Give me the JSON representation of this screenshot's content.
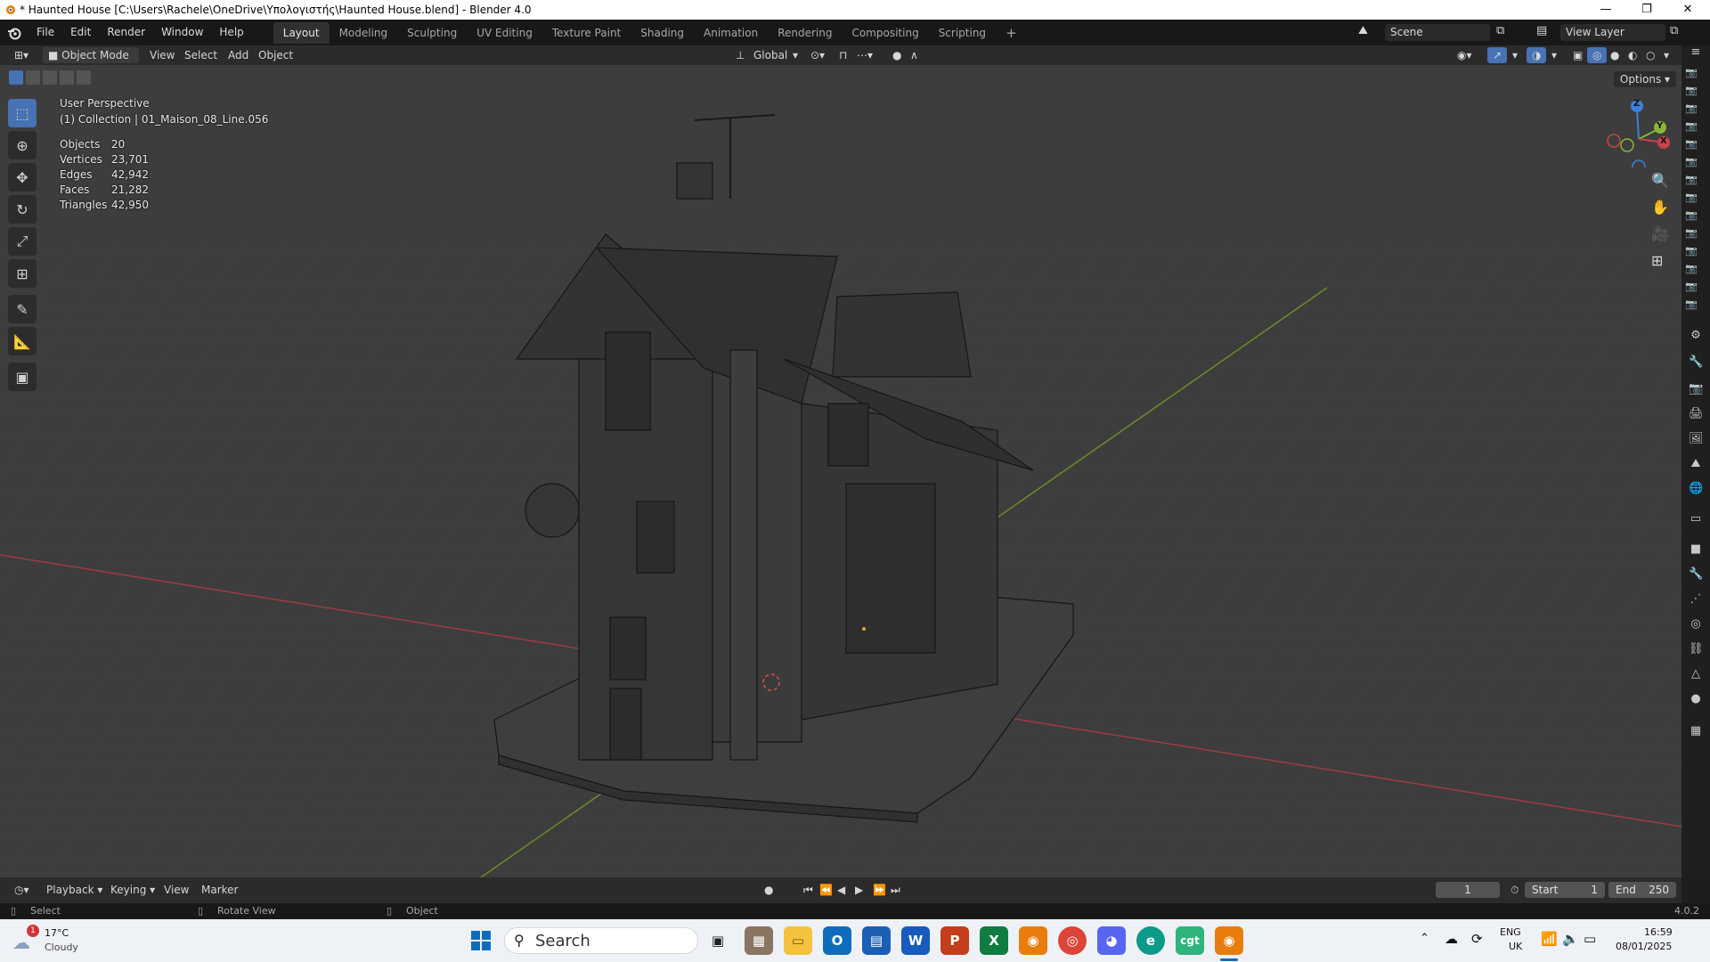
{
  "window": {
    "title": "* Haunted House [C:\\Users\\Rachele\\OneDrive\\Υπολογιστής\\Haunted House.blend] - Blender 4.0",
    "minimize": "—",
    "maximize": "❐",
    "close": "✕"
  },
  "menu": {
    "items": [
      "File",
      "Edit",
      "Render",
      "Window",
      "Help"
    ],
    "workspaces": [
      "Layout",
      "Modeling",
      "Sculpting",
      "UV Editing",
      "Texture Paint",
      "Shading",
      "Animation",
      "Rendering",
      "Compositing",
      "Scripting"
    ],
    "add_workspace": "+",
    "scene": "Scene",
    "view_layer": "View Layer"
  },
  "header": {
    "mode": "Object Mode",
    "view": "View",
    "select": "Select",
    "add": "Add",
    "object": "Object",
    "orientation": "Global",
    "options": "Options"
  },
  "viewport": {
    "perspective": "User Perspective",
    "collection": "(1) Collection | 01_Maison_08_Line.056",
    "stats": [
      {
        "label": "Objects",
        "value": "20"
      },
      {
        "label": "Vertices",
        "value": "23,701"
      },
      {
        "label": "Edges",
        "value": "42,942"
      },
      {
        "label": "Faces",
        "value": "21,282"
      },
      {
        "label": "Triangles",
        "value": "42,950"
      }
    ],
    "gizmo": {
      "z": "Z",
      "y": "Y",
      "x": "X"
    }
  },
  "timeline": {
    "playback": "Playback",
    "keying": "Keying",
    "view": "View",
    "marker": "Marker",
    "current_frame": "1",
    "start_label": "Start",
    "start": "1",
    "end_label": "End",
    "end": "250"
  },
  "statusbar": {
    "select": "Select",
    "rotate": "Rotate View",
    "object": "Object",
    "version": "4.0.2"
  },
  "taskbar": {
    "weather_temp": "17°C",
    "weather_desc": "Cloudy",
    "weather_badge": "1",
    "search": "Search",
    "lang": "ENG",
    "region": "UK",
    "time": "16:59",
    "date": "08/01/2025"
  },
  "colors": {
    "accent": "#4772b3",
    "x_axis": "#c8434a",
    "y_axis": "#87b535",
    "z_axis": "#3d7fd8"
  }
}
